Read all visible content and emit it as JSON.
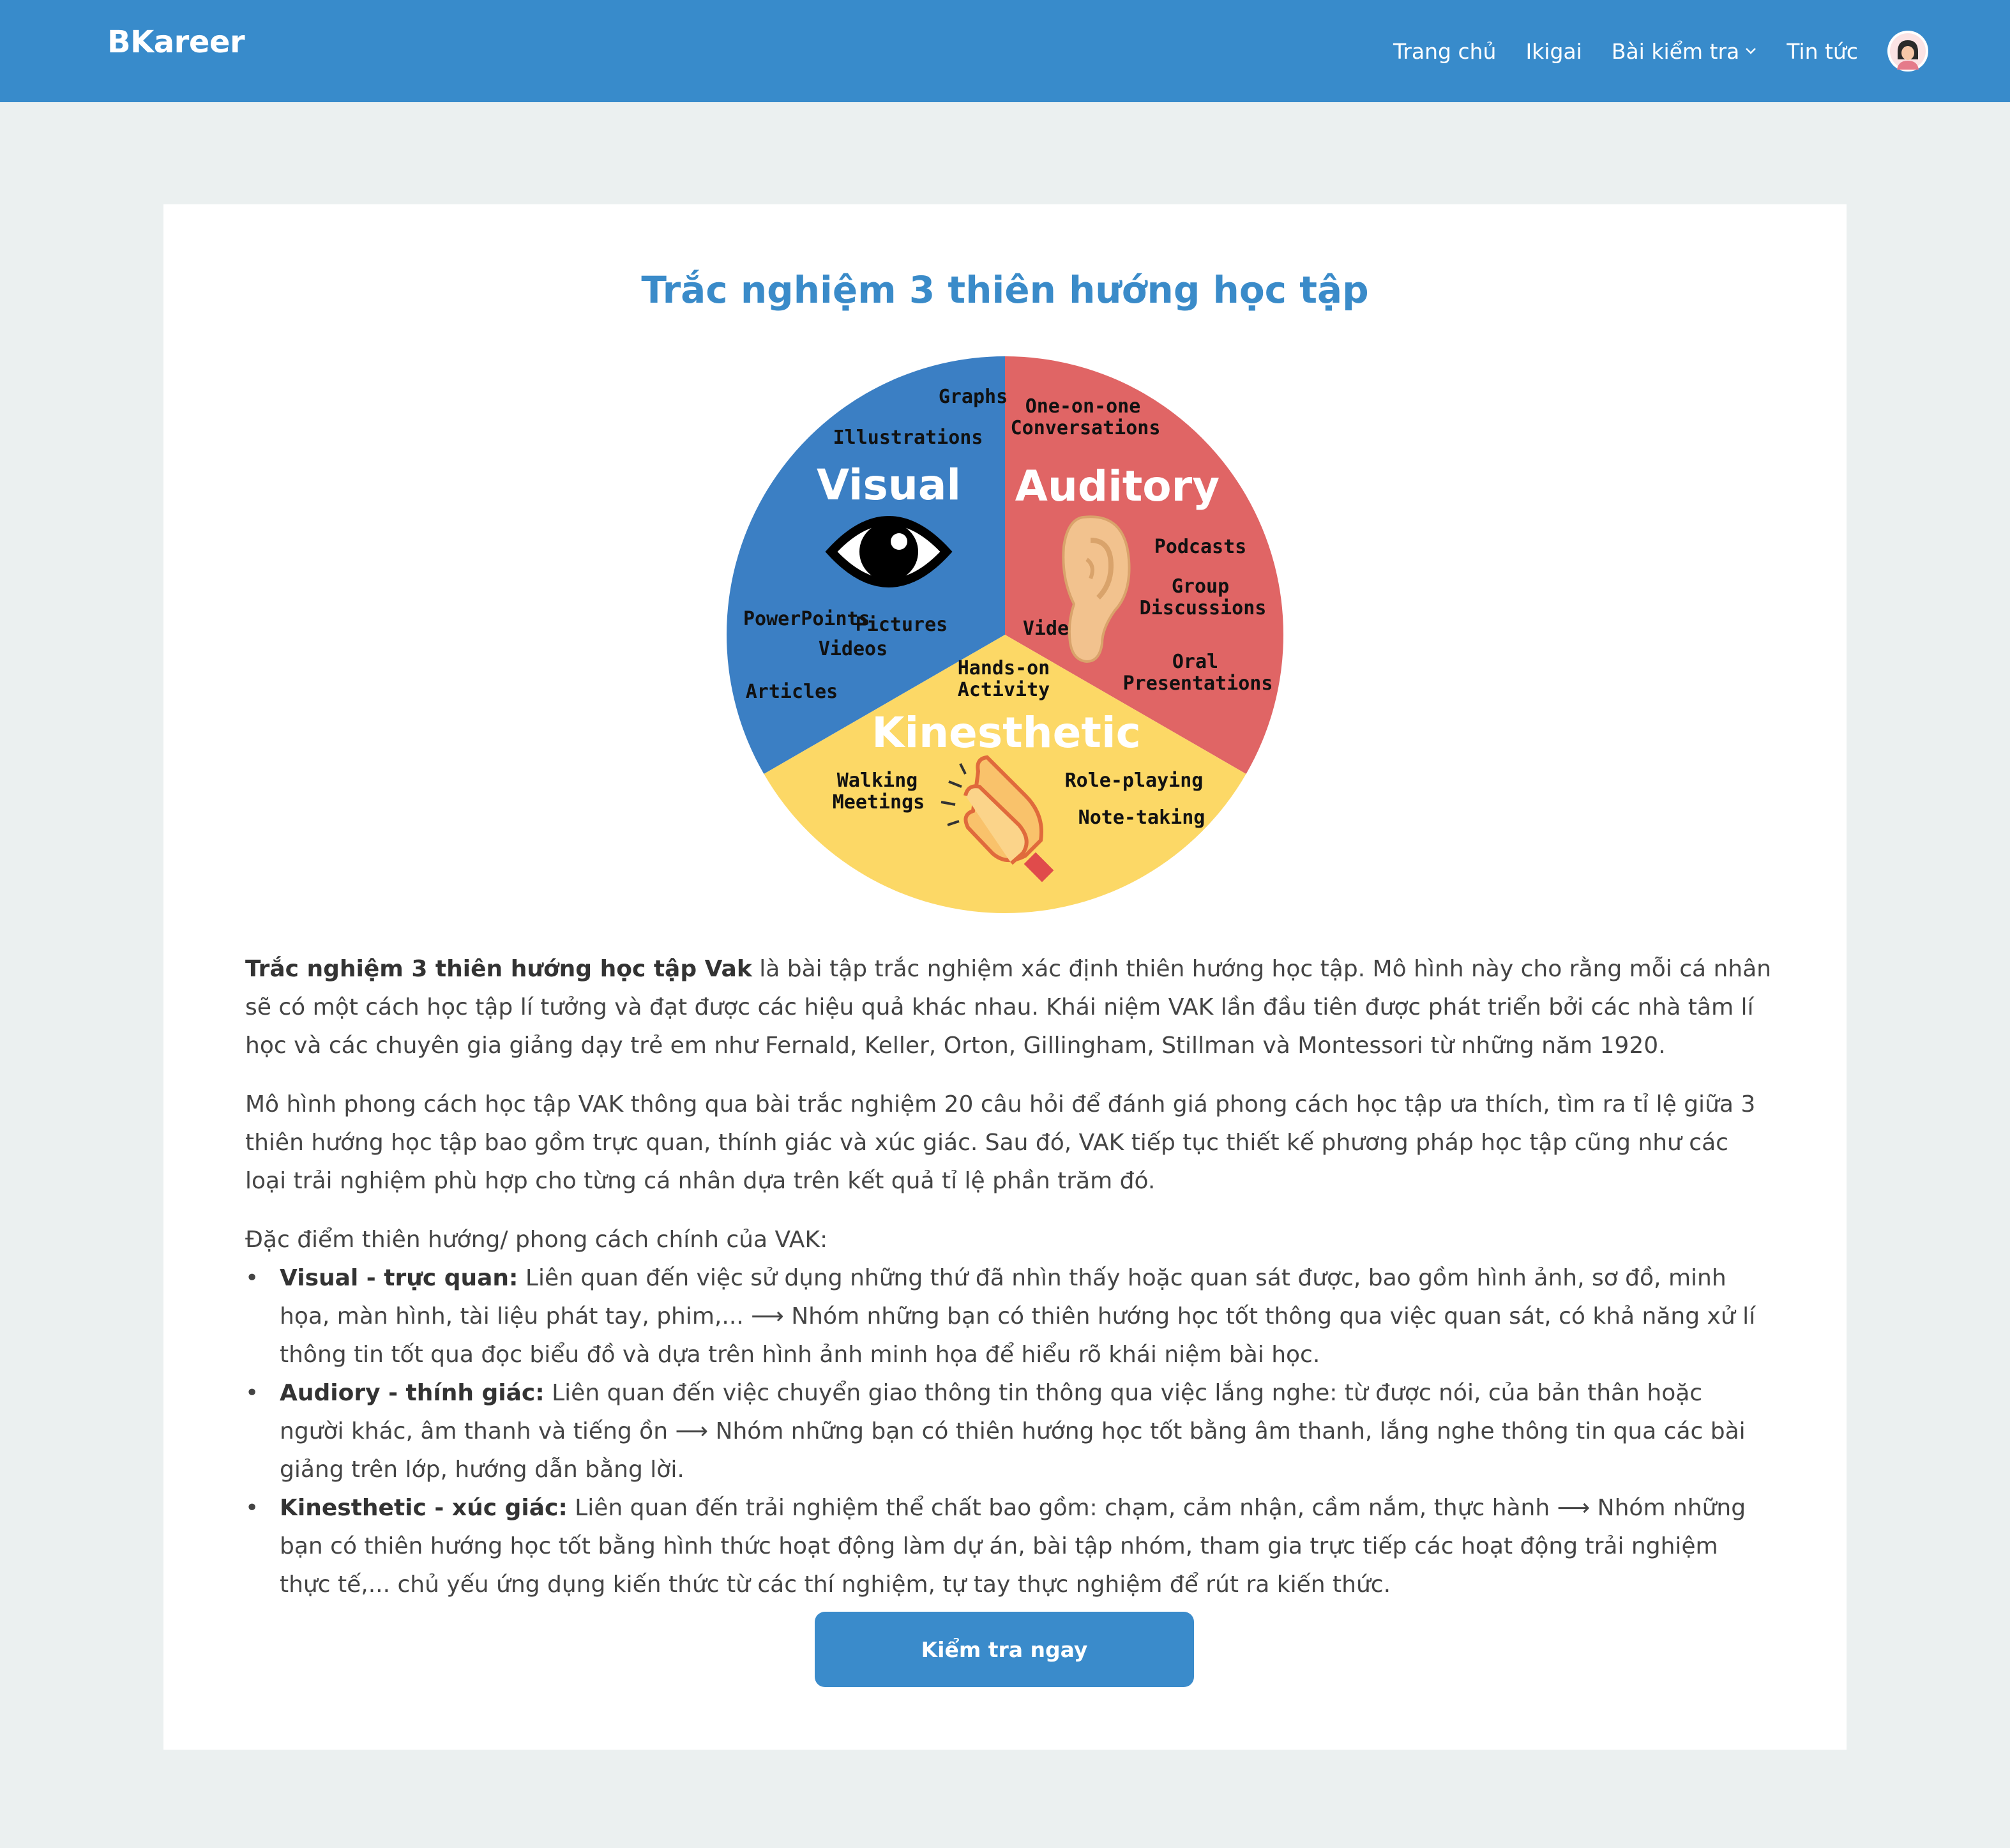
{
  "brand": "BKareer",
  "nav": {
    "items": [
      {
        "label": "Trang chủ"
      },
      {
        "label": "Ikigai"
      },
      {
        "label": "Bài kiểm tra",
        "has_dropdown": true
      },
      {
        "label": "Tin tức"
      }
    ],
    "avatar_icon": "user-avatar-icon"
  },
  "page": {
    "title": "Trắc nghiệm 3 thiên hướng học tập",
    "paragraphs": [
      {
        "bold": "Trắc nghiệm 3 thiên hướng học tập Vak",
        "text": " là bài tập trắc nghiệm xác định thiên hướng học tập. Mô hình này cho rằng mỗi cá nhân sẽ có một cách học tập lí tưởng và đạt được các hiệu quả khác nhau. Khái niệm VAK lần đầu tiên được phát triển bởi các nhà tâm lí học và các chuyên gia giảng dạy trẻ em như Fernald, Keller, Orton, Gillingham, Stillman và Montessori từ những năm 1920."
      },
      {
        "text": "Mô hình phong cách học tập VAK thông qua bài trắc nghiệm 20 câu hỏi để đánh giá phong cách học tập ưa thích, tìm ra tỉ lệ giữa 3 thiên hướng học tập bao gồm trực quan, thính giác và xúc giác. Sau đó, VAK tiếp tục thiết kế phương pháp học tập cũng như các loại trải nghiệm phù hợp cho từng cá nhân dựa trên kết quả tỉ lệ phần trăm đó."
      }
    ],
    "list_intro": "Đặc điểm thiên hướng/ phong cách chính của VAK:",
    "list": [
      {
        "bold": "Visual - trực quan:",
        "text": " Liên quan đến việc sử dụng những thứ đã nhìn thấy hoặc quan sát được, bao gồm hình ảnh, sơ đồ, minh họa, màn hình, tài liệu phát tay, phim,... ⟶ Nhóm những bạn có thiên hướng học tốt thông qua việc quan sát, có khả năng xử lí thông tin tốt qua đọc biểu đồ và dựa trên hình ảnh minh họa để hiểu rõ khái niệm bài học."
      },
      {
        "bold": "Audiory - thính giác:",
        "text": " Liên quan đến việc chuyển giao thông tin thông qua việc lắng nghe: từ được nói, của bản thân hoặc người khác, âm thanh và tiếng ồn ⟶ Nhóm những bạn có thiên hướng học tốt bằng âm thanh, lắng nghe thông tin qua các bài giảng trên lớp, hướng dẫn bằng lời."
      },
      {
        "bold": "Kinesthetic - xúc giác:",
        "text": " Liên quan đến trải nghiệm thể chất bao gồm: chạm, cảm nhận, cầm nắm, thực hành ⟶ Nhóm những bạn có thiên hướng học tốt bằng hình thức hoạt động làm dự án, bài tập nhóm, tham gia trực tiếp các hoạt động trải nghiệm thực tế,... chủ yếu ứng dụng kiến thức từ các thí nghiệm, tự tay thực nghiệm để rút ra kiến thức."
      }
    ],
    "cta_label": "Kiểm tra ngay"
  },
  "vak_chart": {
    "colors": {
      "visual": "#3b7fc4",
      "auditory": "#e06565",
      "kinesthetic": "#fcd866"
    },
    "visual": {
      "title": "Visual",
      "items": [
        "Graphs",
        "Illustrations",
        "PowerPoints",
        "Pictures",
        "Videos",
        "Articles"
      ],
      "icon": "eye-icon"
    },
    "auditory": {
      "title": "Auditory",
      "items": [
        "One-on-one",
        "Conversations",
        "Podcasts",
        "Group",
        "Discussions",
        "Videos",
        "Oral",
        "Presentations"
      ],
      "icon": "ear-icon"
    },
    "kinesthetic": {
      "title": "Kinesthetic",
      "items": [
        "Hands-on",
        "Activity",
        "Walking",
        "Meetings",
        "Role-playing",
        "Note-taking"
      ],
      "icon": "clapping-hands-icon"
    }
  },
  "colors": {
    "primary": "#388bcb",
    "background": "#ebf0f0",
    "title": "#3a8bc9"
  }
}
